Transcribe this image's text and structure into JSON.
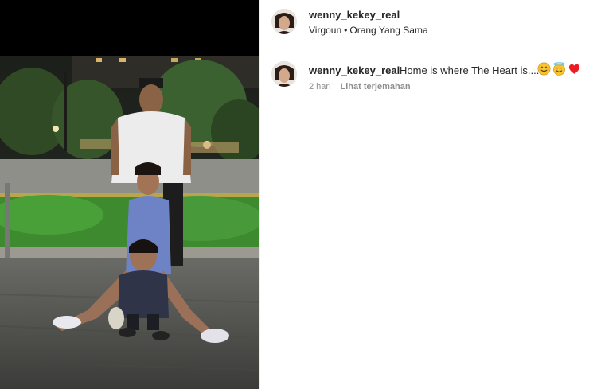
{
  "post": {
    "username": "wenny_kekey_real",
    "audio": {
      "artist": "Virgoun",
      "separator": "•",
      "track": "Orang Yang Sama"
    }
  },
  "caption": {
    "username": "wenny_kekey_real",
    "text": "Home is where The Heart is....",
    "emojis": [
      "smiling-face-icon",
      "smiling-face-with-halo-icon",
      "red-heart-icon"
    ],
    "time": "2 hari",
    "translate_label": "Lihat terjemahan"
  },
  "colors": {
    "text_primary": "#262626",
    "text_secondary": "#8e8e8e",
    "divider": "#efefef",
    "heart": "#ed1c24"
  }
}
